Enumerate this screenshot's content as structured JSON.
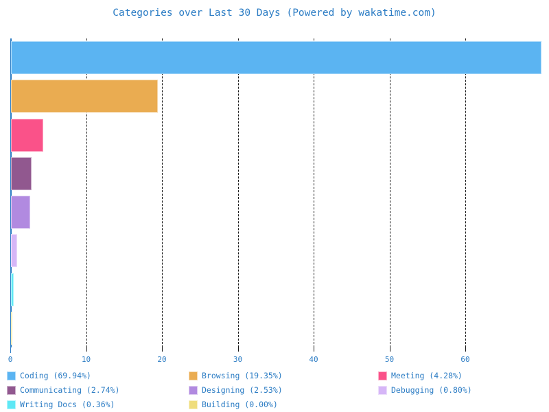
{
  "chart_data": {
    "type": "bar",
    "orientation": "horizontal",
    "title": "Categories over Last 30 Days (Powered by wakatime.com)",
    "xlabel": "",
    "ylabel": "",
    "xlim": [
      0,
      69.8
    ],
    "xticks": [
      0,
      10,
      20,
      30,
      40,
      50,
      60
    ],
    "xtick_labels": [
      "0",
      "10",
      "20",
      "30",
      "40",
      "50",
      "60"
    ],
    "grid": true,
    "grid_axis": "x",
    "grid_style": "dashed",
    "grid_color": "#1a1a1a",
    "legend_position": "bottom",
    "legend_columns": 3,
    "categories": [
      "Coding",
      "Browsing",
      "Meeting",
      "Communicating",
      "Designing",
      "Debugging",
      "Writing Docs",
      "Building"
    ],
    "values": [
      69.94,
      19.35,
      4.28,
      2.74,
      2.53,
      0.8,
      0.36,
      0.0
    ],
    "percent_labels": [
      "69.94%",
      "19.35%",
      "4.28%",
      "2.74%",
      "2.53%",
      "0.80%",
      "0.36%",
      "0.00%"
    ],
    "colors": [
      "#5bb4f2",
      "#eaac51",
      "#fa5289",
      "#91588f",
      "#b18ae0",
      "#d6b6f7",
      "#5fe8f5",
      "#efdd7c"
    ],
    "series": [
      {
        "name": "Categories",
        "values": [
          69.94,
          19.35,
          4.28,
          2.74,
          2.53,
          0.8,
          0.36,
          0.0
        ]
      }
    ]
  },
  "legend": {
    "items": [
      {
        "label": "Coding (69.94%)",
        "color": "#5bb4f2"
      },
      {
        "label": "Browsing (19.35%)",
        "color": "#eaac51"
      },
      {
        "label": "Meeting (4.28%)",
        "color": "#fa5289"
      },
      {
        "label": "Communicating (2.74%)",
        "color": "#91588f"
      },
      {
        "label": "Designing (2.53%)",
        "color": "#b18ae0"
      },
      {
        "label": "Debugging (0.80%)",
        "color": "#d6b6f7"
      },
      {
        "label": "Writing Docs (0.36%)",
        "color": "#5fe8f5"
      },
      {
        "label": "Building (0.00%)",
        "color": "#efdd7c"
      }
    ]
  },
  "theme": {
    "accent": "#2b7cc4",
    "background": "#ffffff",
    "axis_color": "#2b7cc4",
    "grid_color": "#1a1a1a"
  }
}
